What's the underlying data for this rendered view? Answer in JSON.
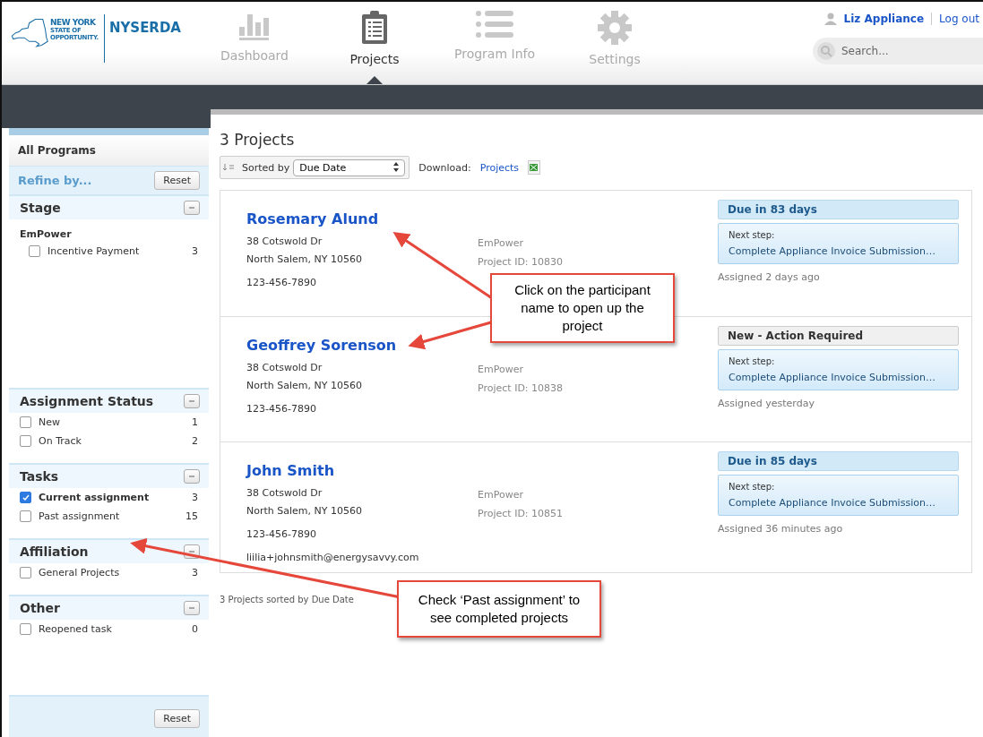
{
  "logo": {
    "line1": "NEW YORK",
    "line2": "STATE OF",
    "line3": "OPPORTUNITY.",
    "brand": "NYSERDA"
  },
  "nav": [
    {
      "label": "Dashboard",
      "selected": false
    },
    {
      "label": "Projects",
      "selected": true
    },
    {
      "label": "Program Info",
      "selected": false
    },
    {
      "label": "Settings",
      "selected": false
    }
  ],
  "user": {
    "name": "Liz Appliance",
    "logout": "Log out"
  },
  "search": {
    "placeholder": "Search..."
  },
  "sidebar": {
    "title": "All Programs",
    "refine": "Refine by...",
    "reset": "Reset",
    "bottom_reset": "Reset",
    "sections": [
      {
        "title": "Stage",
        "expanded": true,
        "groups": [
          {
            "name": "EmPower",
            "items": [
              {
                "label": "Incentive Payment",
                "count": "3",
                "checked": false
              }
            ]
          }
        ]
      },
      {
        "title": "Assignment Status",
        "expanded": true,
        "groups": [
          {
            "items": [
              {
                "label": "New",
                "count": "1",
                "checked": false
              },
              {
                "label": "On Track",
                "count": "2",
                "checked": false
              }
            ]
          }
        ]
      },
      {
        "title": "Tasks",
        "expanded": true,
        "groups": [
          {
            "items": [
              {
                "label": "Current assignment",
                "count": "3",
                "checked": true
              },
              {
                "label": "Past assignment",
                "count": "15",
                "checked": false
              }
            ]
          }
        ]
      },
      {
        "title": "Affiliation",
        "expanded": true,
        "groups": [
          {
            "items": [
              {
                "label": "General Projects",
                "count": "3",
                "checked": false
              }
            ]
          }
        ]
      },
      {
        "title": "Other",
        "expanded": true,
        "groups": [
          {
            "items": [
              {
                "label": "Reopened task",
                "count": "0",
                "checked": false
              }
            ]
          }
        ]
      }
    ]
  },
  "main": {
    "title": "3 Projects",
    "sorted_by": "Sorted by",
    "sort_value": "Due Date",
    "download": "Download:",
    "download_link": "Projects",
    "footer": "3 Projects sorted by Due Date"
  },
  "projects": [
    {
      "name": "Rosemary Alund",
      "street": "38 Cotswold Dr",
      "city": "North Salem, NY 10560",
      "phone": "123-456-7890",
      "program": "EmPower",
      "project_id": "Project ID: 10830",
      "status": "Due in 83 days",
      "kind": "due",
      "next_label": "Next step:",
      "next_step": "Complete Appliance Invoice Submission…",
      "assigned": "Assigned 2 days ago"
    },
    {
      "name": "Geoffrey Sorenson",
      "street": "38 Cotswold Dr",
      "city": "North Salem, NY 10560",
      "phone": "123-456-7890",
      "program": "EmPower",
      "project_id": "Project ID: 10838",
      "status": "New - Action Required",
      "kind": "new",
      "next_label": "Next step:",
      "next_step": "Complete Appliance Invoice Submission…",
      "assigned": "Assigned yesterday"
    },
    {
      "name": "John Smith",
      "street": "38 Cotswold Dr",
      "city": "North Salem, NY 10560",
      "phone": "123-456-7890",
      "email": "liilia+johnsmith@energysavvy.com",
      "program": "EmPower",
      "project_id": "Project ID: 10851",
      "status": "Due in 85 days",
      "kind": "due",
      "next_label": "Next step:",
      "next_step": "Complete Appliance Invoice Submission…",
      "assigned": "Assigned 36 minutes ago"
    }
  ],
  "callouts": [
    {
      "text": "Click on the participant name to open up the project"
    },
    {
      "text": "Check ‘Past assignment’ to see completed projects"
    }
  ]
}
